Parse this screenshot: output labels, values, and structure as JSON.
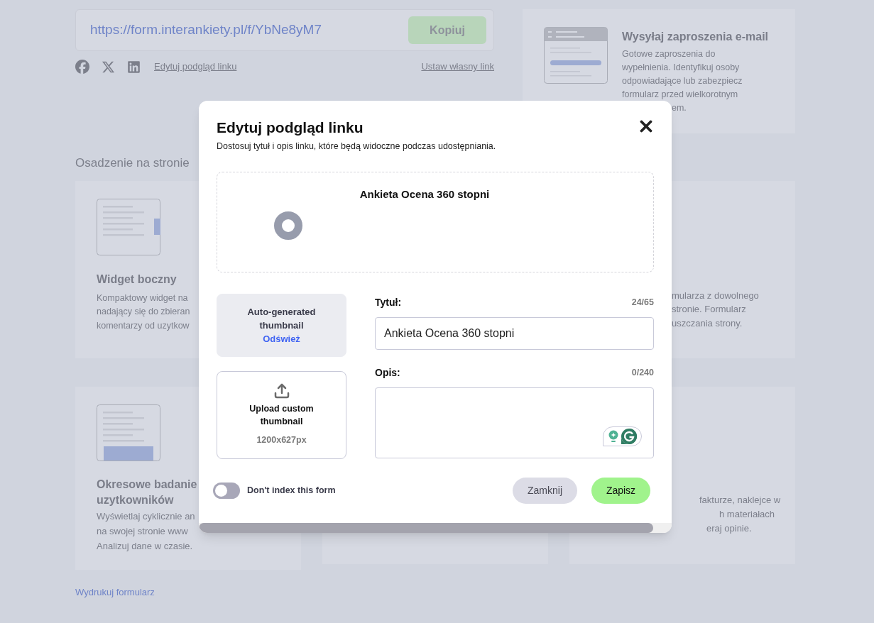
{
  "share": {
    "url": "https://form.interankiety.pl/f/YbNe8yM7",
    "copy_button": "Kopiuj",
    "edit_preview_link": "Edytuj podgląd linku",
    "custom_link": "Ustaw własny link"
  },
  "email_card": {
    "title": "Wysyłaj zaproszenia e-mail",
    "lines": [
      "Gotowe zaproszenia do",
      "wypełnienia. Identyfikuj osoby",
      "odpowiadające lub zabezpiecz",
      "formularz przed wielkorotnym"
    ],
    "fragments": [
      "em."
    ]
  },
  "embed_heading": "Osadzenie na stronie",
  "sidebar_widget_card": {
    "title": "Widget boczny",
    "lines": [
      "Kompaktowy widget na",
      "nadający się do zbieran",
      "komentarzy od uzytkow"
    ]
  },
  "right_embed_card": {
    "fragments": [
      "mularza z dowolnego",
      "stronie. Formularz",
      "uszczania strony."
    ]
  },
  "periodic_card": {
    "title_lines": [
      "Okresowe badanie",
      "uzytkowników"
    ],
    "lines": [
      "Wyświetlaj cyklicznie an",
      "na swojej stronie www",
      "Analizuj dane w czasie."
    ]
  },
  "bottom_right_card": {
    "fragments": [
      "fakturze, naklejce w",
      "h materiałach",
      "eraj opinie."
    ]
  },
  "print_link": "Wydrukuj formularz",
  "dialog": {
    "title": "Edytuj podgląd linku",
    "subtitle": "Dostosuj tytuł i opis linku, które będą widoczne podczas udostępniania.",
    "preview": {
      "title": "Ankieta Ocena 360 stopni"
    },
    "thumbnail_options": [
      {
        "kind": "auto",
        "label": "Auto-generated thumbnail",
        "action": "Odśwież",
        "selected": true
      },
      {
        "kind": "upload",
        "label": "Upload custom thumbnail",
        "hint": "1200x627px",
        "selected": false
      }
    ],
    "fields": [
      {
        "kind": "input",
        "label": "Tytuł:",
        "counter": "24/65",
        "value": "Ankieta Ocena 360 stopni"
      },
      {
        "kind": "textarea",
        "label": "Opis:",
        "counter": "0/240"
      }
    ],
    "no_index": {
      "label": "Don't index this form",
      "on": false
    },
    "buttons": [
      {
        "kind": "secondary",
        "label": "Zamknij"
      },
      {
        "kind": "primary",
        "label": "Zapisz"
      }
    ]
  }
}
